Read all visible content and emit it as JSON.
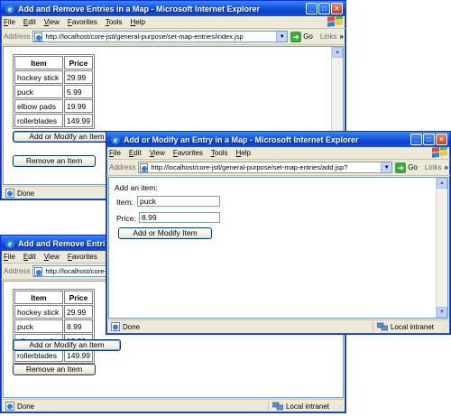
{
  "window_back_top": {
    "title": "Add and Remove Entries in a Map - Microsoft Internet Explorer",
    "address_label": "Address",
    "url": "http://localhost/core-jstl/general-purpose/set-map-entries/index.jsp",
    "go_label": "Go",
    "links_label": "Links",
    "table": {
      "headers": [
        "Item",
        "Price"
      ],
      "rows": [
        [
          "hockey stick",
          "29.99"
        ],
        [
          "puck",
          "5.99"
        ],
        [
          "elbow pads",
          "19.99"
        ],
        [
          "rollerblades",
          "149.99"
        ]
      ]
    },
    "add_button": "Add or Modify an Item",
    "remove_button": "Remove an Item",
    "status": "Done"
  },
  "window_back_bottom": {
    "title": "Add and Remove Entries in a Map - Microsoft Internet Explorer",
    "address_label": "Address",
    "url": "http://localhost/core-jstl/general-purpose/set-map-entries/index.jsp",
    "table": {
      "headers": [
        "Item",
        "Price"
      ],
      "rows": [
        [
          "hockey stick",
          "29.99"
        ],
        [
          "puck",
          "8.99"
        ],
        [
          "elbow pads",
          "19.99"
        ],
        [
          "rollerblades",
          "149.99"
        ]
      ]
    },
    "add_button": "Add or Modify an Item",
    "remove_button": "Remove an Item",
    "status": "Done",
    "zone": "Local intranet"
  },
  "window_front": {
    "title": "Add or Modify an Entry in a Map - Microsoft Internet Explorer",
    "address_label": "Address",
    "url": "http://localhost/core-jstl/general-purpose/set-map-entries/add.jsp?",
    "go_label": "Go",
    "links_label": "Links",
    "heading": "Add an item:",
    "item_label": "Item:",
    "item_value": "puck",
    "price_label": "Price:",
    "price_value": "8.99",
    "submit_button": "Add or Modify Item",
    "status": "Done",
    "zone": "Local intranet"
  },
  "menu": [
    "File",
    "Edit",
    "View",
    "Favorites",
    "Tools",
    "Help"
  ],
  "colors": {
    "titlebar": "#0a3fcf",
    "chrome": "#ece9d8",
    "border": "#0831d9"
  },
  "icons": [
    "ie-icon",
    "minimize-icon",
    "maximize-icon",
    "close-icon",
    "windows-logo-icon",
    "page-icon",
    "dropdown-icon",
    "go-arrow-icon",
    "done-icon",
    "network-icon"
  ]
}
